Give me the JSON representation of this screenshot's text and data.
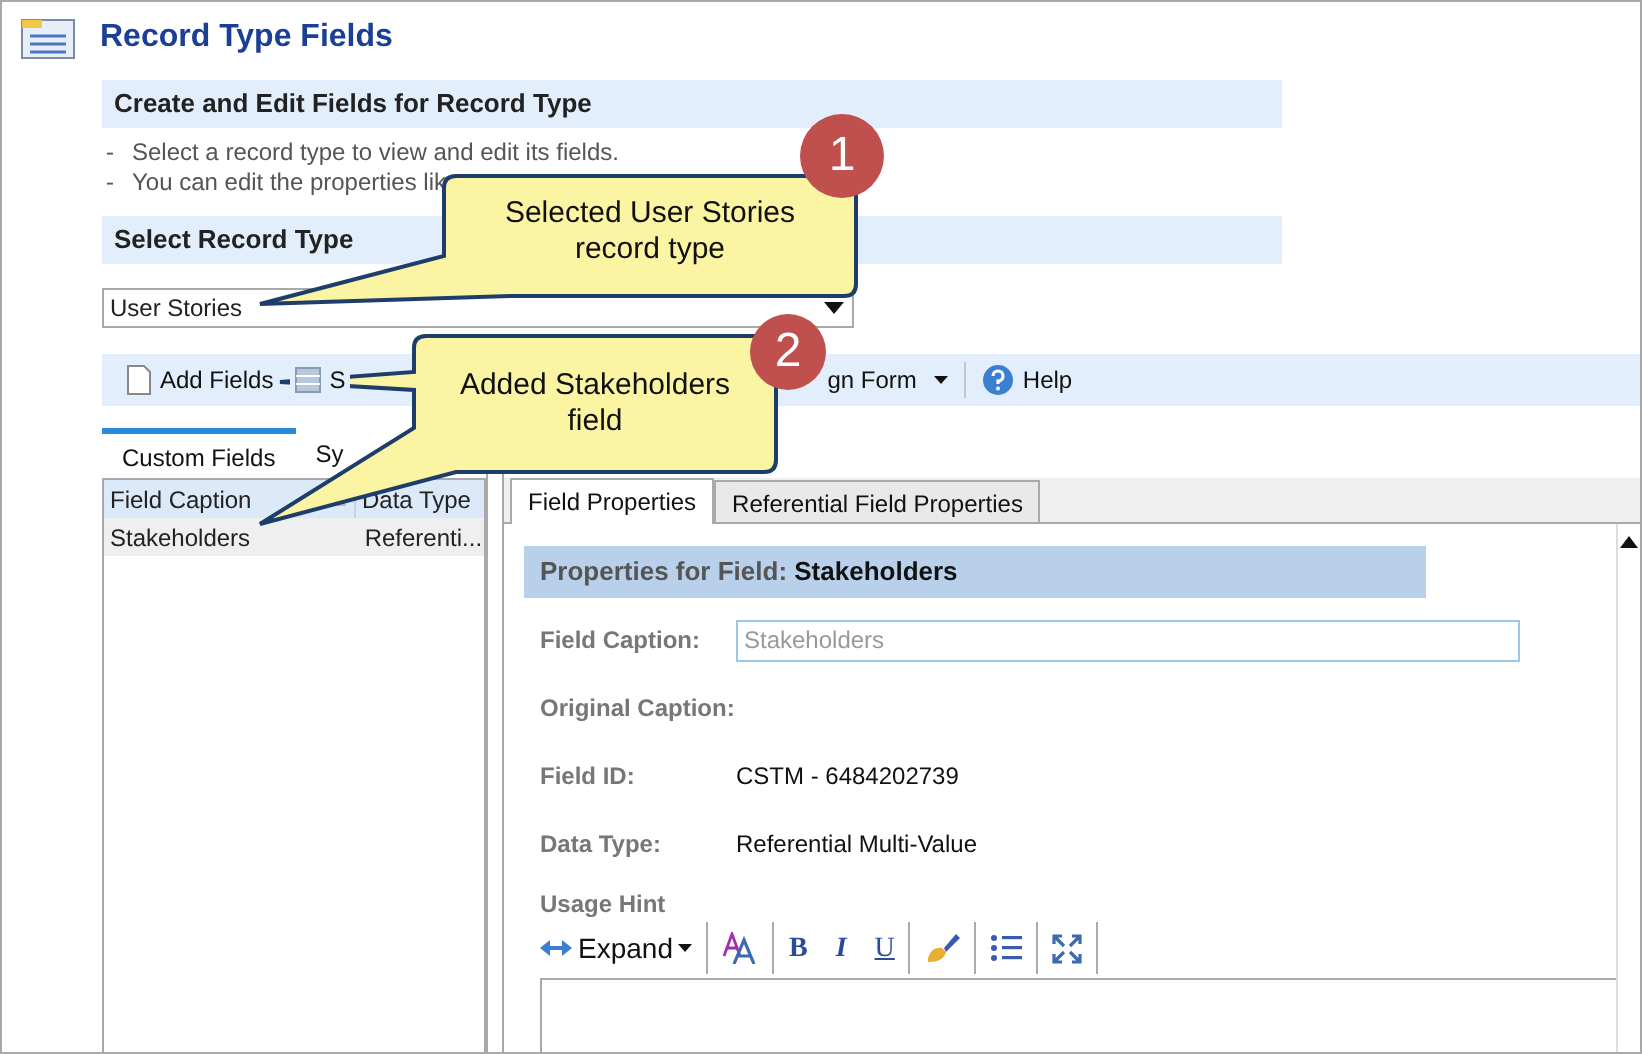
{
  "page": {
    "title": "Record Type Fields"
  },
  "intro": {
    "heading": "Create and Edit Fields for Record Type",
    "bullets": [
      {
        "dash": "-",
        "text": "Select a record type to view and edit its fields."
      },
      {
        "dash": "-",
        "text": "You can edit the properties lik"
      }
    ]
  },
  "record_type": {
    "heading": "Select Record Type",
    "value": "User Stories"
  },
  "toolbar": [
    {
      "kind": "new",
      "label": "Add Fields"
    },
    {
      "kind": "save",
      "label": "S"
    },
    {
      "kind": "menu",
      "label": "gn Form"
    },
    {
      "kind": "help",
      "label": "Help"
    }
  ],
  "field_tabs": [
    {
      "label": "Custom Fields",
      "selected": true
    },
    {
      "label": "Sy",
      "selected": false
    }
  ],
  "fields_table": {
    "columns": [
      "Field Caption",
      "Data Type"
    ],
    "rows": [
      {
        "cells": [
          "Stakeholders",
          "Referenti..."
        ],
        "selected": true
      }
    ]
  },
  "property_tabs": [
    {
      "label": "Field Properties",
      "selected": true
    },
    {
      "label": "Referential Field Properties",
      "selected": false
    }
  ],
  "properties": {
    "heading": "Properties for Field: **Stakeholders**",
    "fields": [
      {
        "kind": "input",
        "label": "Field Caption:",
        "value": "Stakeholders",
        "disabled": true
      },
      {
        "kind": "text",
        "label": "Original Caption:"
      },
      {
        "kind": "text",
        "label": "Field ID:",
        "value": "CSTM - 6484202739"
      },
      {
        "kind": "text",
        "label": "Data Type:",
        "value": "Referential Multi-Value"
      }
    ],
    "usage_hint": {
      "label": "Usage Hint",
      "editor_toolbar": [
        {
          "kind": "expand",
          "label": "Expand"
        },
        {
          "kind": "font"
        },
        {
          "kind": "bold",
          "label": "B"
        },
        {
          "kind": "italic",
          "label": "I"
        },
        {
          "kind": "underline",
          "label": "U"
        },
        {
          "kind": "brush"
        },
        {
          "kind": "list"
        },
        {
          "kind": "fullscreen"
        }
      ]
    }
  },
  "callouts": [
    {
      "number": "1",
      "text": "Selected User Stories record type"
    },
    {
      "number": "2",
      "text": "Added Stakeholders field"
    }
  ]
}
